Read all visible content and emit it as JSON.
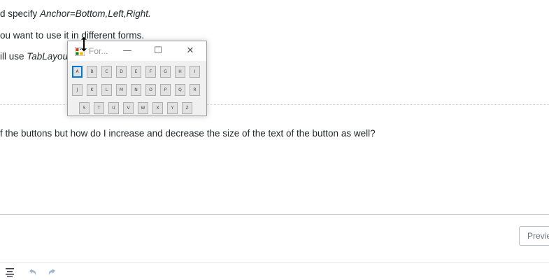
{
  "answer": {
    "line1_pre": "d specify ",
    "line1_em": "Anchor=Bottom,Left,Right.",
    "line2": "ou want to use it in different forms.",
    "line3_pre": "ill use ",
    "line3_em": "TabLayou"
  },
  "comment": {
    "text": "f the buttons but how do I increase and decrease the size of the text of the button as well?"
  },
  "editor": {
    "preview_label": "Previe",
    "toolbar_icons": [
      "align-icon",
      "undo-icon",
      "redo-icon"
    ]
  },
  "form_window": {
    "title": "For...",
    "controls": {
      "minimize": "—",
      "maximize": "☐",
      "close": "✕"
    },
    "focused_key": "A",
    "rows": [
      [
        "A",
        "B",
        "C",
        "D",
        "E",
        "F",
        "G",
        "H",
        "I"
      ],
      [
        "J",
        "K",
        "L",
        "M",
        "N",
        "O",
        "P",
        "Q",
        "R"
      ],
      [
        "S",
        "T",
        "U",
        "V",
        "W",
        "X",
        "Y",
        "Z"
      ]
    ]
  }
}
